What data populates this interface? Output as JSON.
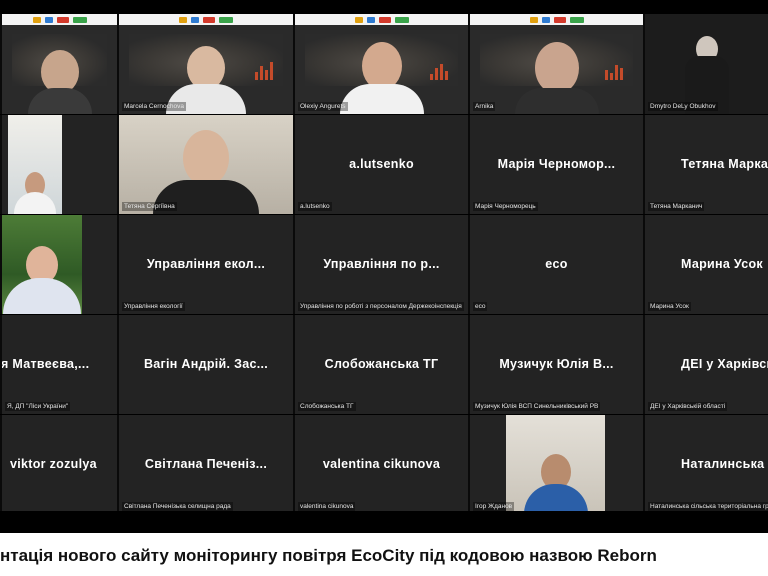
{
  "participants": {
    "r1": [
      {
        "label": ""
      },
      {
        "label": "Marcela Cernochova"
      },
      {
        "label": "Olexiy Angurets"
      },
      {
        "label": "Arnika"
      },
      {
        "label": "Dmytro DeLy Obukhov"
      }
    ],
    "r2": [
      {
        "label": ""
      },
      {
        "label": "Тетяна Сергіївна"
      },
      {
        "center": "a.lutsenko",
        "label": "a.lutsenko"
      },
      {
        "center": "Марія Черномор...",
        "label": "Марія Черноморець"
      },
      {
        "center": "Тетяна Марканич",
        "label": "Тетяна Марканич"
      }
    ],
    "r3": [
      {
        "label": ""
      },
      {
        "center": "Управління екол...",
        "label": "Управління екології"
      },
      {
        "center": "Управління по р...",
        "label": "Управління по роботі з персоналом Держекоінспекція"
      },
      {
        "center": "eco",
        "label": "eco"
      },
      {
        "center": "Марина Усок",
        "label": "Марина Усок"
      }
    ],
    "r4": [
      {
        "center": "фія Матвеєва,...",
        "label": "Я, ДП \"Ліси України\""
      },
      {
        "center": "Вагін Андрій. Зас...",
        "label": ""
      },
      {
        "center": "Слобожанська ТГ",
        "label": "Слобожанська ТГ"
      },
      {
        "center": "Музичук Юлія В...",
        "label": "Музичук Юлія ВСП Синельниківський РВ"
      },
      {
        "center": "ДЕІ у Харківські",
        "label": "ДЕІ у Харківській області"
      }
    ],
    "r5": [
      {
        "center": "viktor zozulya",
        "label": ""
      },
      {
        "center": "Світлана Печеніз...",
        "label": "Світлана Печенізька селищна рада"
      },
      {
        "center": "valentina cikunova",
        "label": "valentina cikunova"
      },
      {
        "label": "Ігор Жданов"
      },
      {
        "center": "Наталинська сіл",
        "label": "Наталинська сільська територіальна громада"
      }
    ]
  },
  "caption": "нтація нового сайту моніторингу повітря EcoCity під кодовою назвою Reborn",
  "colors": {
    "tile_bg": "#232323",
    "stage_bg": "#000000",
    "caption_bg": "#ffffff"
  }
}
